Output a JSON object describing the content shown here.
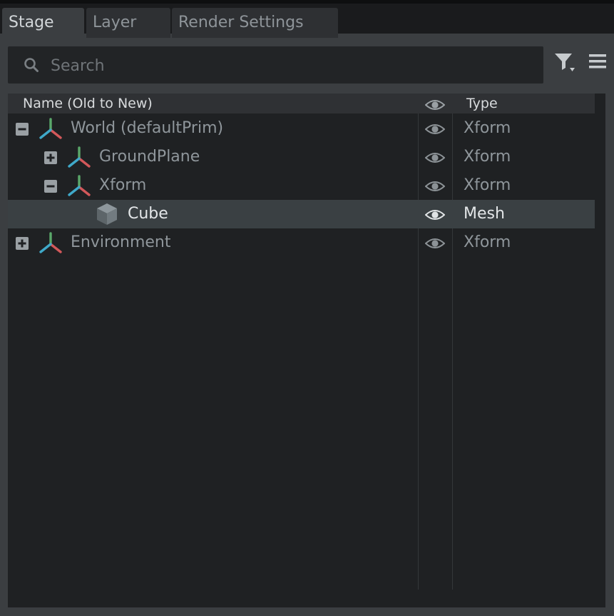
{
  "tabs": [
    {
      "label": "Stage",
      "active": true
    },
    {
      "label": "Layer",
      "active": false
    },
    {
      "label": "Render Settings",
      "active": false
    }
  ],
  "search": {
    "placeholder": "Search",
    "value": ""
  },
  "toolbar": {
    "filter_icon": "filter-icon",
    "menu_icon": "hamburger-menu-icon"
  },
  "columns": {
    "name": "Name (Old to New)",
    "visibility_icon": "eye-icon",
    "type": "Type"
  },
  "tree": [
    {
      "label": "World (defaultPrim)",
      "type": "Xform",
      "depth": 0,
      "expander": "collapse",
      "icon": "xform-axis-icon",
      "selected": false
    },
    {
      "label": "GroundPlane",
      "type": "Xform",
      "depth": 1,
      "expander": "expand",
      "icon": "xform-axis-icon",
      "selected": false
    },
    {
      "label": "Xform",
      "type": "Xform",
      "depth": 1,
      "expander": "collapse",
      "icon": "xform-axis-icon",
      "selected": false
    },
    {
      "label": "Cube",
      "type": "Mesh",
      "depth": 2,
      "expander": "none",
      "icon": "mesh-cube-icon",
      "selected": true
    },
    {
      "label": "Environment",
      "type": "Xform",
      "depth": 0,
      "expander": "expand",
      "icon": "xform-axis-icon",
      "selected": false
    }
  ],
  "colors": {
    "panel_bg": "#1f2123",
    "selected_row": "#3a4043",
    "axis_x": "#d2585a",
    "axis_y": "#5aa86a",
    "axis_z": "#3fa9c9"
  }
}
